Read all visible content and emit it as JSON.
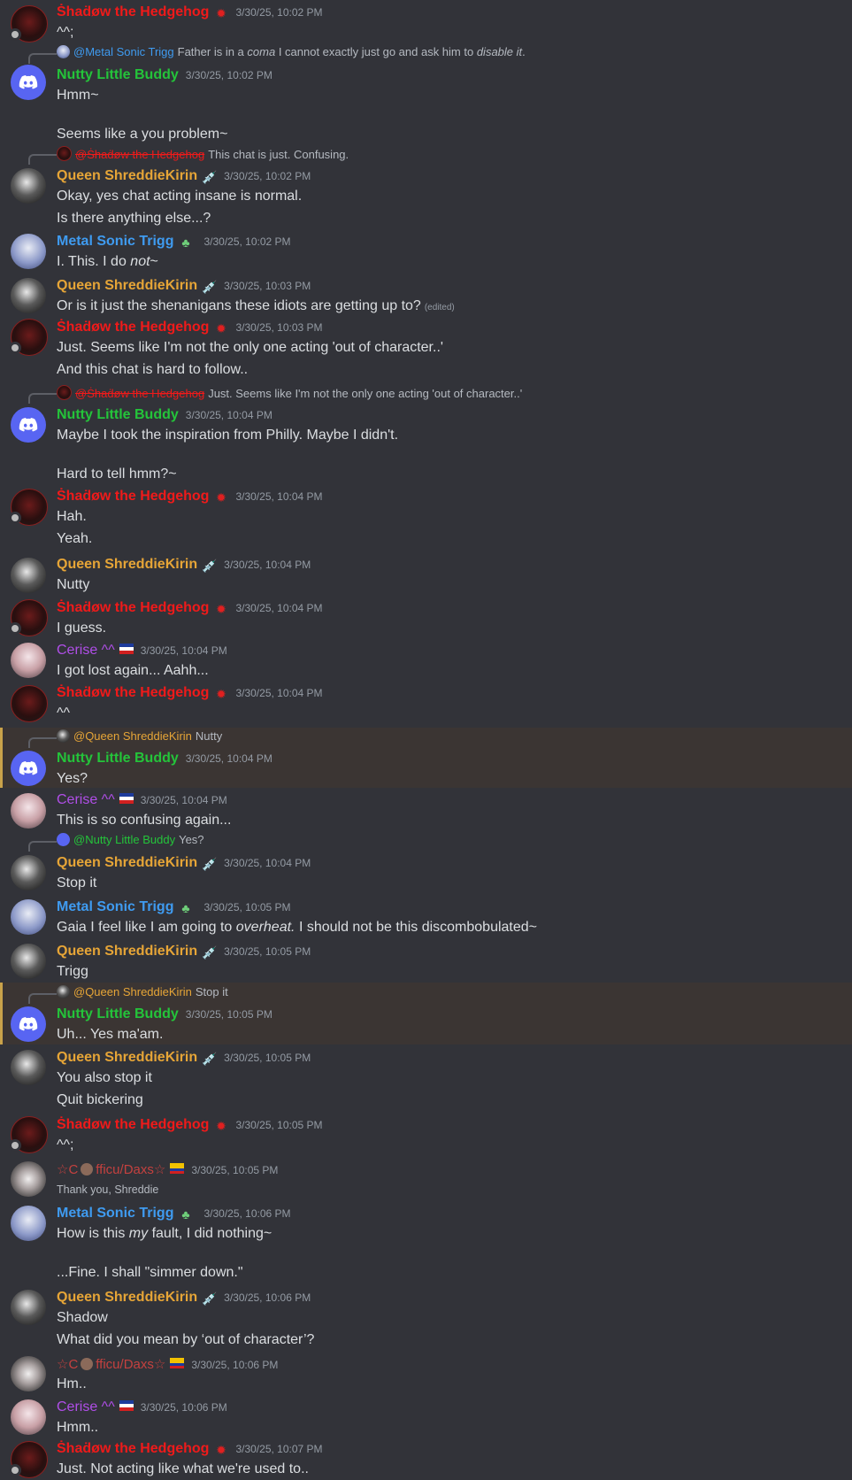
{
  "colors": {
    "shadow": "#f01a1a",
    "nutty": "#24c43a",
    "queen": "#e6a537",
    "metal": "#3f9bf0",
    "cerise": "#b04ee8",
    "daxs": "#c4413f",
    "timestamp": "#949ba4",
    "background": "#323339"
  },
  "icons": {
    "shadow_badge": "red-emblem-icon",
    "queen_badge": "syringe-icon",
    "metal_badge": "green-clover-icon",
    "cerise_badge": "flag-icon",
    "daxs_badge": "flag-icon",
    "daxs_coffee": "coffee-cup-icon"
  },
  "users": {
    "shadow": "Ṡhaḋøw the Hedgehog",
    "nutty": "Nutty Little Buddy",
    "queen": "Queen ShreddieKirin",
    "metal": "Metal Sonic Trigg",
    "cerise": "Cerise ^^",
    "daxs_pre": "☆C",
    "daxs_post": "fficu/Daxs☆"
  },
  "messages": [
    {
      "user": "shadow",
      "ts": "3/30/25, 10:02 PM",
      "lines": [
        "^^;"
      ]
    },
    {
      "user": "nutty",
      "ts": "3/30/25, 10:02 PM",
      "reply": {
        "user": "metal",
        "name": "@Metal Sonic Trigg",
        "t1": "Father is in a ",
        "em": "coma",
        "t2": " I cannot exactly just go and ask him to ",
        "em2": "disable it",
        "t3": "."
      },
      "lines": [
        "Hmm~",
        "",
        "Seems like a you problem~"
      ]
    },
    {
      "user": "queen",
      "ts": "3/30/25, 10:02 PM",
      "reply": {
        "user": "shadow",
        "name": "@Ṡhaḋøw the Hedgehog",
        "t1": "This chat is just. Confusing."
      },
      "lines": [
        "Okay, yes chat acting insane is normal.",
        "Is there anything else...?"
      ]
    },
    {
      "user": "metal",
      "ts": "3/30/25, 10:02 PM",
      "lines_rich": [
        {
          "t1": "I. This. I do ",
          "em": "not",
          "t2": "~"
        }
      ]
    },
    {
      "user": "queen",
      "ts": "3/30/25, 10:03 PM",
      "lines": [
        "Or is it just the shenanigans these idiots are getting up to?"
      ],
      "edited": "(edited)"
    },
    {
      "user": "shadow",
      "ts": "3/30/25, 10:03 PM",
      "lines": [
        "Just. Seems like I'm not the only one acting 'out of character..'",
        "And this chat is hard to follow.."
      ]
    },
    {
      "user": "nutty",
      "ts": "3/30/25, 10:04 PM",
      "reply": {
        "user": "shadow",
        "name": "@Ṡhaḋøw the Hedgehog",
        "t1": "Just. Seems like I'm not the only one acting 'out of character..'"
      },
      "lines": [
        "Maybe I took the inspiration from Philly. Maybe I didn't.",
        "",
        "Hard to tell hmm?~"
      ]
    },
    {
      "user": "shadow",
      "ts": "3/30/25, 10:04 PM",
      "lines": [
        "Hah.",
        "Yeah."
      ]
    },
    {
      "user": "queen",
      "ts": "3/30/25, 10:04 PM",
      "lines": [
        "Nutty"
      ]
    },
    {
      "user": "shadow",
      "ts": "3/30/25, 10:04 PM",
      "lines": [
        "I guess."
      ]
    },
    {
      "user": "cerise",
      "ts": "3/30/25, 10:04 PM",
      "lines": [
        "I got lost again... Aahh..."
      ]
    },
    {
      "user": "shadow",
      "ts": "3/30/25, 10:04 PM",
      "lines": [
        "^^"
      ]
    },
    {
      "user": "nutty",
      "ts": "3/30/25, 10:04 PM",
      "reply": {
        "user": "queen",
        "name": "@Queen ShreddieKirin",
        "t1": "Nutty"
      },
      "lines": [
        "Yes?"
      ]
    },
    {
      "user": "cerise",
      "ts": "3/30/25, 10:04 PM",
      "lines": [
        "This is so confusing again..."
      ]
    },
    {
      "user": "queen",
      "ts": "3/30/25, 10:04 PM",
      "reply": {
        "user": "nutty",
        "name": "@Nutty Little Buddy",
        "t1": "Yes?"
      },
      "lines": [
        "Stop it"
      ]
    },
    {
      "user": "metal",
      "ts": "3/30/25, 10:05 PM",
      "lines_rich": [
        {
          "t1": "Gaia I feel like I am going to ",
          "em": "overheat.",
          "t2": " I should not be this discombobulated~"
        }
      ]
    },
    {
      "user": "queen",
      "ts": "3/30/25, 10:05 PM",
      "lines": [
        "Trigg"
      ]
    },
    {
      "user": "nutty",
      "ts": "3/30/25, 10:05 PM",
      "reply": {
        "user": "queen",
        "name": "@Queen ShreddieKirin",
        "t1": "Stop it"
      },
      "lines": [
        "Uh... Yes ma'am."
      ]
    },
    {
      "user": "queen",
      "ts": "3/30/25, 10:05 PM",
      "lines": [
        "You also stop it",
        "Quit bickering"
      ]
    },
    {
      "user": "shadow",
      "ts": "3/30/25, 10:05 PM",
      "lines": [
        "^^;"
      ]
    },
    {
      "user": "daxs",
      "ts": "3/30/25, 10:05 PM",
      "small": "Thank you, Shreddie"
    },
    {
      "user": "metal",
      "ts": "3/30/25, 10:06 PM",
      "lines_rich": [
        {
          "t1": "How is this ",
          "em": "my",
          "t2": " fault, I did nothing~"
        },
        {
          "t1": ""
        },
        {
          "t1": "...Fine. I shall \"simmer down.\""
        }
      ]
    },
    {
      "user": "queen",
      "ts": "3/30/25, 10:06 PM",
      "lines": [
        "Shadow",
        "What did you mean by ‘out of character’?"
      ]
    },
    {
      "user": "daxs",
      "ts": "3/30/25, 10:06 PM",
      "lines": [
        "Hm.."
      ]
    },
    {
      "user": "cerise",
      "ts": "3/30/25, 10:06 PM",
      "lines": [
        "Hmm.."
      ]
    },
    {
      "user": "shadow",
      "ts": "3/30/25, 10:07 PM",
      "lines": [
        "Just. Not acting like what we're used to.."
      ]
    }
  ]
}
